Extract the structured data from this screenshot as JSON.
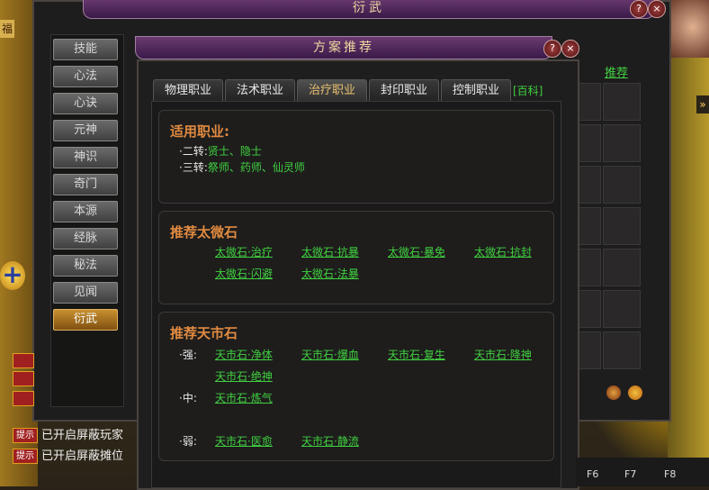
{
  "outer_window": {
    "title": "衍武",
    "help": "?",
    "close": "×"
  },
  "side_tab": "福",
  "sidebar": {
    "items": [
      "技能",
      "心法",
      "心诀",
      "元神",
      "神识",
      "奇门",
      "本源",
      "经脉",
      "秘法",
      "见闻",
      "衍武"
    ],
    "active": "衍武"
  },
  "right_panel": {
    "recommend_link": "推荐"
  },
  "dialog": {
    "title": "方案推荐",
    "help": "?",
    "close": "×",
    "tabs": [
      "物理职业",
      "法术职业",
      "治疗职业",
      "封印职业",
      "控制职业"
    ],
    "active_tab": "治疗职业",
    "wiki_link": "[百科]",
    "jobs": {
      "title": "适用职业:",
      "row1_label": "·二转:",
      "row1_value": "贤士、隐士",
      "row2_label": "·三转:",
      "row2_value": "祭师、药师、仙灵师"
    },
    "taiwei": {
      "title": "推荐太微石",
      "links": [
        "太微石·治疗",
        "太微石·抗暴",
        "太微石·暴免",
        "太微石·抗封",
        "太微石·闪避",
        "太微石·法暴"
      ]
    },
    "tianshi": {
      "title": "推荐天市石",
      "strong_label": "·强:",
      "strong": [
        "天市石·净体",
        "天市石·爆血",
        "天市石·复生",
        "天市石·降神",
        "天市石·绝神"
      ],
      "mid_label": "·中:",
      "mid": [
        "天市石·炼气"
      ],
      "weak_label": "·弱:",
      "weak": [
        "天市石·医愈",
        "天市石·静流"
      ]
    }
  },
  "chat": {
    "tip_label": "提示",
    "line1": "已开启屏蔽玩家",
    "line2": "已开启屏蔽摊位"
  },
  "fkeys": [
    "F6",
    "F7",
    "F8"
  ],
  "colors": {
    "link_green": "#40d040",
    "section_orange": "#e08a40"
  }
}
